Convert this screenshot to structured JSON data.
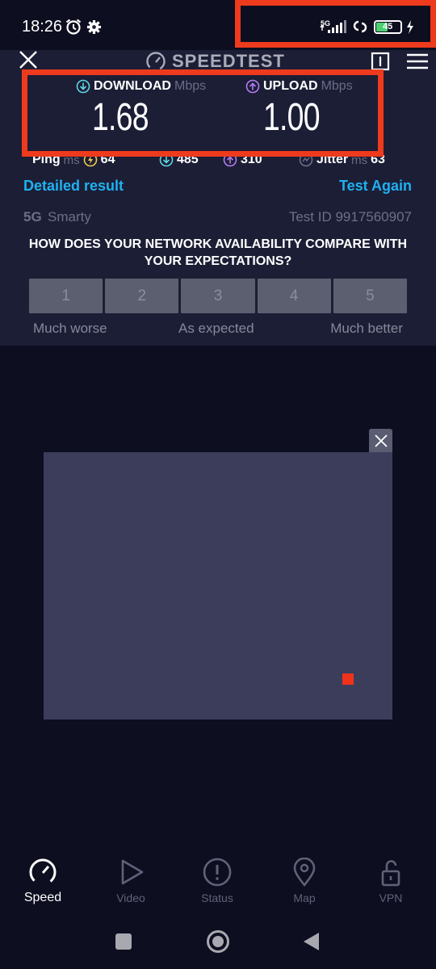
{
  "status_bar": {
    "time": "18:26",
    "network": "5G",
    "battery": "45"
  },
  "header": {
    "app_name": "SPEEDTEST"
  },
  "results": {
    "download_label": "DOWNLOAD",
    "download_unit": "Mbps",
    "download_value": "1.68",
    "upload_label": "UPLOAD",
    "upload_unit": "Mbps",
    "upload_value": "1.00",
    "ping_label": "Ping",
    "ping_unit": "ms",
    "ping_idle": "64",
    "ping_download": "485",
    "ping_upload": "310",
    "jitter_label": "Jitter",
    "jitter_unit": "ms",
    "jitter_value": "63"
  },
  "links": {
    "detailed_result": "Detailed result",
    "test_again": "Test Again"
  },
  "network": {
    "type": "5G",
    "provider": "Smarty",
    "test_id": "Test ID 9917560907"
  },
  "survey": {
    "question_line1": "HOW DOES YOUR NETWORK AVAILABILITY COMPARE WITH",
    "question_line2": "YOUR EXPECTATIONS?",
    "options": [
      "1",
      "2",
      "3",
      "4",
      "5"
    ],
    "label_low": "Much worse",
    "label_mid": "As expected",
    "label_high": "Much better"
  },
  "bottom_nav": {
    "items": [
      {
        "label": "Speed",
        "icon": "speedometer-icon"
      },
      {
        "label": "Video",
        "icon": "play-icon"
      },
      {
        "label": "Status",
        "icon": "alert-icon"
      },
      {
        "label": "Map",
        "icon": "map-pin-icon"
      },
      {
        "label": "VPN",
        "icon": "unlock-icon"
      }
    ]
  },
  "colors": {
    "background": "#0d0e1f",
    "panel": "#1c1e36",
    "accent_link": "#1fb1f0",
    "highlight_box": "#ee3a1d",
    "download_icon": "#5fd6e0",
    "upload_icon": "#b47cf2"
  }
}
